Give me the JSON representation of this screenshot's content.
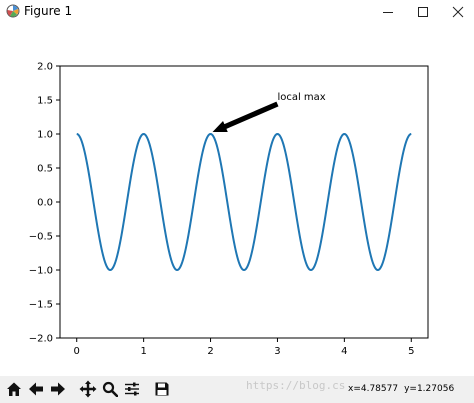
{
  "window": {
    "title": "Figure 1",
    "icon": "matplotlib-logo-icon",
    "controls": [
      "minimize-icon",
      "maximize-icon",
      "close-icon"
    ]
  },
  "chart_data": {
    "type": "line",
    "function": "cos(2*pi*x)",
    "x": [
      0,
      0.1,
      0.2,
      0.3,
      0.4,
      0.5,
      0.6,
      0.7,
      0.8,
      0.9,
      1.0,
      1.1,
      1.2,
      1.3,
      1.4,
      1.5,
      1.6,
      1.7,
      1.8,
      1.9,
      2.0,
      2.1,
      2.2,
      2.3,
      2.4,
      2.5,
      2.6,
      2.7,
      2.8,
      2.9,
      3.0,
      3.1,
      3.2,
      3.3,
      3.4,
      3.5,
      3.6,
      3.7,
      3.8,
      3.9,
      4.0,
      4.1,
      4.2,
      4.3,
      4.4,
      4.5,
      4.6,
      4.7,
      4.8,
      4.9,
      5.0
    ],
    "y": [
      1.0,
      0.809,
      0.309,
      -0.309,
      -0.809,
      -1.0,
      -0.809,
      -0.309,
      0.309,
      0.809,
      1.0,
      0.809,
      0.309,
      -0.309,
      -0.809,
      -1.0,
      -0.809,
      -0.309,
      0.309,
      0.809,
      1.0,
      0.809,
      0.309,
      -0.309,
      -0.809,
      -1.0,
      -0.809,
      -0.309,
      0.309,
      0.809,
      1.0,
      0.809,
      0.309,
      -0.309,
      -0.809,
      -1.0,
      -0.809,
      -0.309,
      0.309,
      0.809,
      1.0,
      0.809,
      0.309,
      -0.309,
      -0.809,
      -1.0,
      -0.809,
      -0.309,
      0.309,
      0.809,
      1.0
    ],
    "xlim": [
      -0.25,
      5.25
    ],
    "ylim": [
      -2.0,
      2.0
    ],
    "xticks": [
      "0",
      "1",
      "2",
      "3",
      "4",
      "5"
    ],
    "yticks": [
      "2.0",
      "1.5",
      "1.0",
      "0.5",
      "0.0",
      "−0.5",
      "−1.0",
      "−1.5",
      "−2.0"
    ],
    "line_color": "#1f77b4",
    "grid": false,
    "annotation": {
      "text": "local max",
      "xy": [
        2,
        1
      ],
      "xytext": [
        3,
        1.5
      ],
      "arrow_color": "#000000"
    }
  },
  "toolbar": {
    "buttons": [
      "home-icon",
      "back-icon",
      "forward-icon",
      "pan-icon",
      "zoom-icon",
      "configure-subplots-icon",
      "save-icon"
    ],
    "coords": {
      "x": "x=4.78577",
      "y": "y=1.27056"
    },
    "watermark": "https://blog.cs"
  }
}
